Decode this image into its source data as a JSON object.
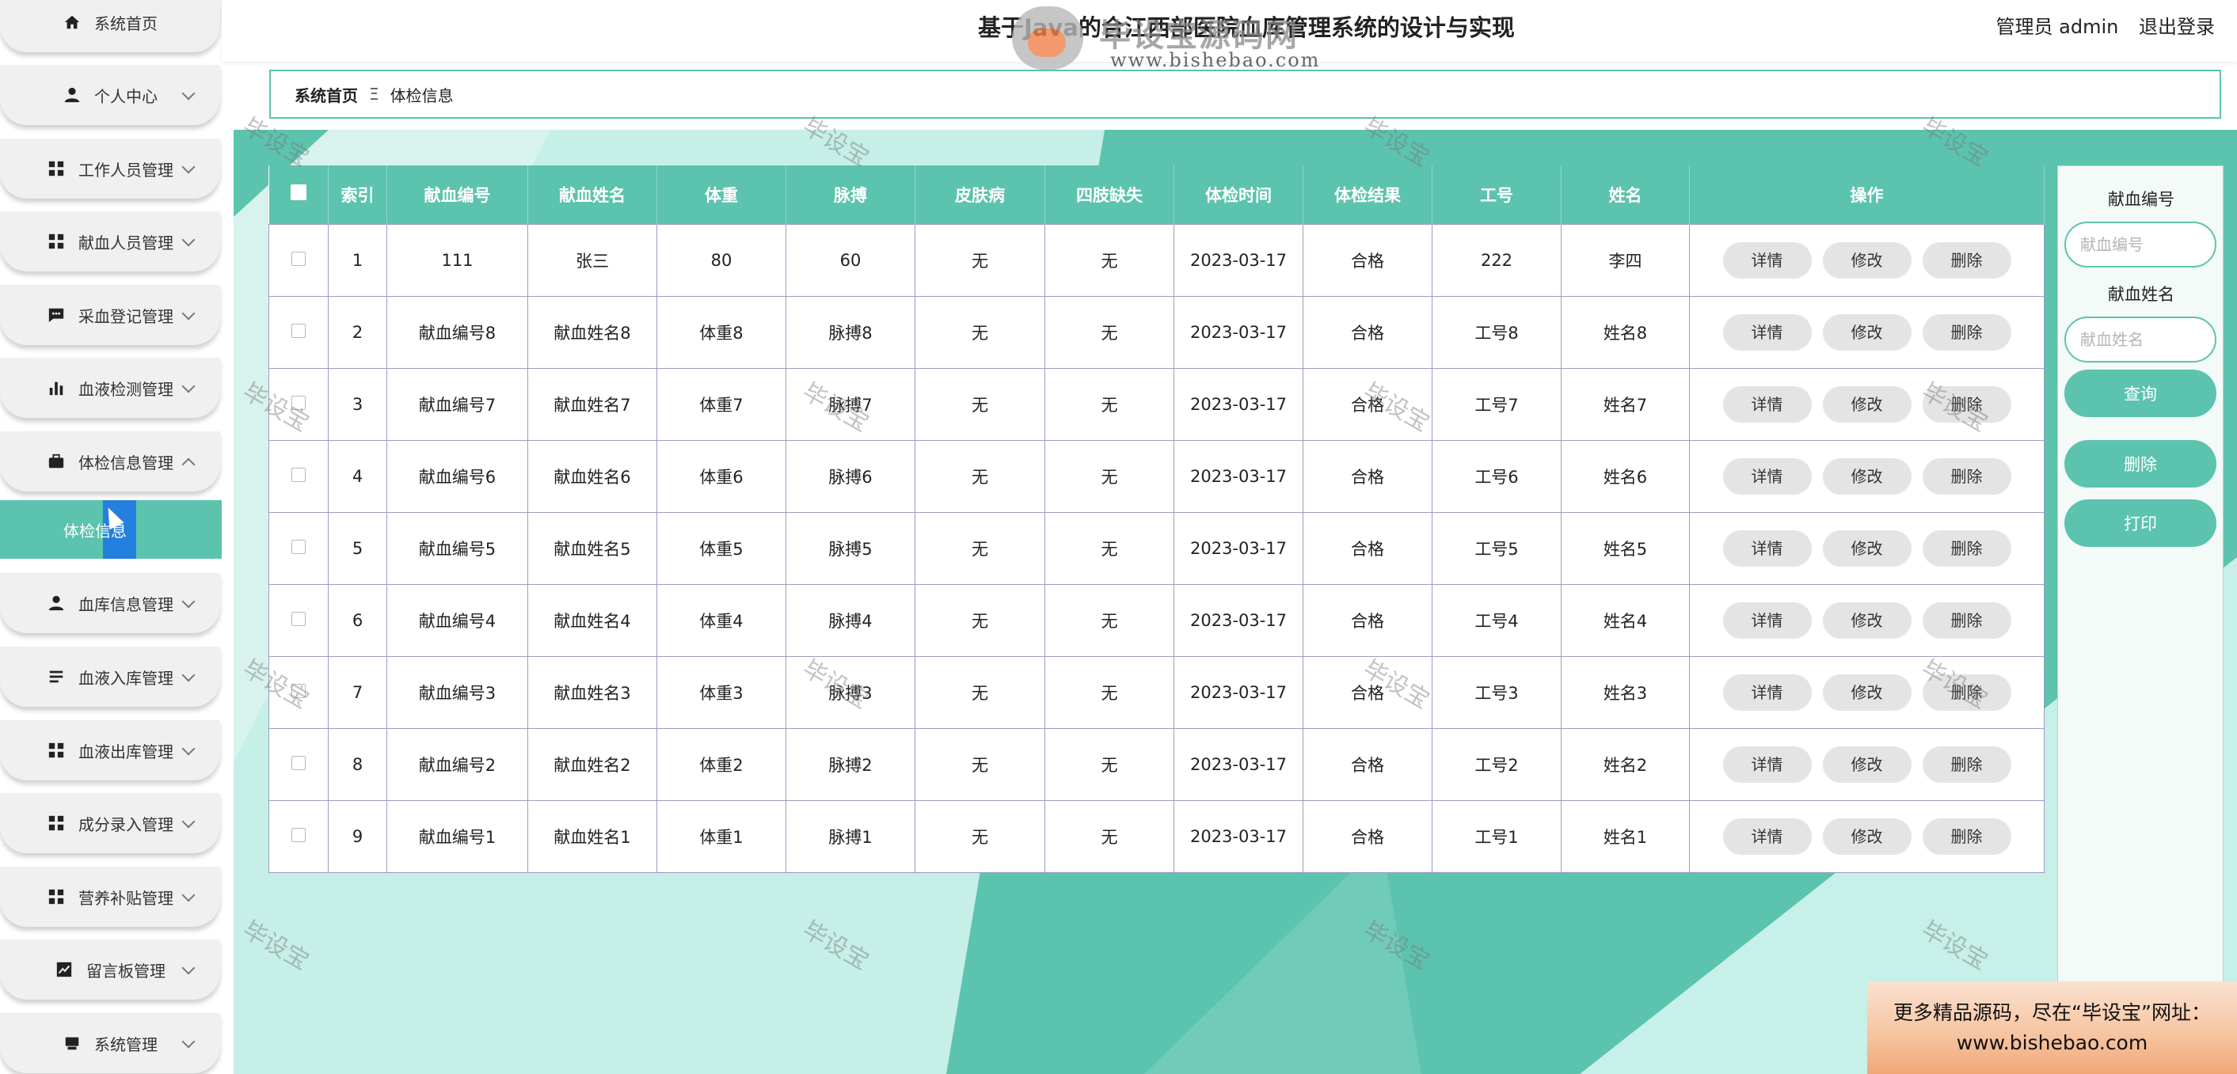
{
  "app": {
    "title": "基于Java的合江西部医院血库管理系统的设计与实现",
    "user_role": "管理员 admin",
    "logout": "退出登录",
    "logo_text": "毕设宝源码网",
    "logo_url": "www.bishebao.com"
  },
  "sidebar": {
    "items": [
      {
        "label": "系统首页",
        "icon": "home-icon",
        "expandable": false
      },
      {
        "label": "个人中心",
        "icon": "person-icon",
        "expandable": true
      },
      {
        "label": "工作人员管理",
        "icon": "grid-icon",
        "expandable": true
      },
      {
        "label": "献血人员管理",
        "icon": "grid-icon",
        "expandable": true
      },
      {
        "label": "采血登记管理",
        "icon": "chat-icon",
        "expandable": true
      },
      {
        "label": "血液检测管理",
        "icon": "bar-chart-icon",
        "expandable": true
      },
      {
        "label": "体检信息管理",
        "icon": "briefcase-icon",
        "expandable": true,
        "expanded": true
      },
      {
        "label": "血库信息管理",
        "icon": "person-icon",
        "expandable": true
      },
      {
        "label": "血液入库管理",
        "icon": "list-icon",
        "expandable": true
      },
      {
        "label": "血液出库管理",
        "icon": "grid-icon",
        "expandable": true
      },
      {
        "label": "成分录入管理",
        "icon": "grid-icon",
        "expandable": true
      },
      {
        "label": "营养补贴管理",
        "icon": "grid-icon",
        "expandable": true
      },
      {
        "label": "留言板管理",
        "icon": "trend-icon",
        "expandable": true
      },
      {
        "label": "系统管理",
        "icon": "monitor-icon",
        "expandable": true
      }
    ],
    "submenu": {
      "label": "体检信息"
    }
  },
  "breadcrumb": {
    "home": "系统首页",
    "separator": "Ξ",
    "current": "体检信息"
  },
  "table": {
    "columns": [
      "索引",
      "献血编号",
      "献血姓名",
      "体重",
      "脉搏",
      "皮肤病",
      "四肢缺失",
      "体检时间",
      "体检结果",
      "工号",
      "姓名",
      "操作"
    ],
    "actions": {
      "detail": "详情",
      "edit": "修改",
      "delete": "删除"
    },
    "rows": [
      [
        "1",
        "111",
        "张三",
        "80",
        "60",
        "无",
        "无",
        "2023-03-17",
        "合格",
        "222",
        "李四"
      ],
      [
        "2",
        "献血编号8",
        "献血姓名8",
        "体重8",
        "脉搏8",
        "无",
        "无",
        "2023-03-17",
        "合格",
        "工号8",
        "姓名8"
      ],
      [
        "3",
        "献血编号7",
        "献血姓名7",
        "体重7",
        "脉搏7",
        "无",
        "无",
        "2023-03-17",
        "合格",
        "工号7",
        "姓名7"
      ],
      [
        "4",
        "献血编号6",
        "献血姓名6",
        "体重6",
        "脉搏6",
        "无",
        "无",
        "2023-03-17",
        "合格",
        "工号6",
        "姓名6"
      ],
      [
        "5",
        "献血编号5",
        "献血姓名5",
        "体重5",
        "脉搏5",
        "无",
        "无",
        "2023-03-17",
        "合格",
        "工号5",
        "姓名5"
      ],
      [
        "6",
        "献血编号4",
        "献血姓名4",
        "体重4",
        "脉搏4",
        "无",
        "无",
        "2023-03-17",
        "合格",
        "工号4",
        "姓名4"
      ],
      [
        "7",
        "献血编号3",
        "献血姓名3",
        "体重3",
        "脉搏3",
        "无",
        "无",
        "2023-03-17",
        "合格",
        "工号3",
        "姓名3"
      ],
      [
        "8",
        "献血编号2",
        "献血姓名2",
        "体重2",
        "脉搏2",
        "无",
        "无",
        "2023-03-17",
        "合格",
        "工号2",
        "姓名2"
      ],
      [
        "9",
        "献血编号1",
        "献血姓名1",
        "体重1",
        "脉搏1",
        "无",
        "无",
        "2023-03-17",
        "合格",
        "工号1",
        "姓名1"
      ]
    ]
  },
  "search": {
    "donor_id_label": "献血编号",
    "donor_id_placeholder": "献血编号",
    "donor_name_label": "献血姓名",
    "donor_name_placeholder": "献血姓名",
    "query_button": "查询",
    "delete_button": "删除",
    "print_button": "打印"
  },
  "watermark": "毕设宝",
  "promo": {
    "line1": "更多精品源码，尽在“毕设宝”网址：",
    "line2": "www.bishebao.com"
  },
  "colors": {
    "accent": "#5cc3ae",
    "sidebar_bg": "#f0f0f0",
    "button_gray": "#e4e4e4"
  }
}
